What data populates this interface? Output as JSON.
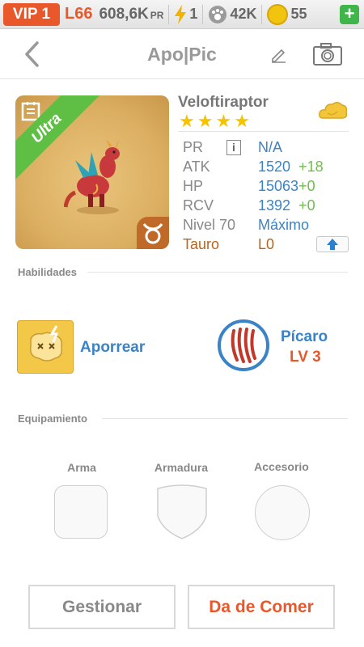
{
  "status": {
    "vip": "VIP 1",
    "level": "L66",
    "power": "608,6K",
    "power_unit": "PR",
    "energy": "1",
    "paws": "42K",
    "coins": "55",
    "plus": "+"
  },
  "header": {
    "title": "Apo|Pic"
  },
  "pet": {
    "rarity": "Ultra",
    "name": "Veloftiraptor",
    "stars": 4,
    "stats": [
      {
        "label": "PR",
        "value": "N/A",
        "bonus": ""
      },
      {
        "label": "ATK",
        "value": "1520",
        "bonus": "+18"
      },
      {
        "label": "HP",
        "value": "15063",
        "bonus": "+0"
      },
      {
        "label": "RCV",
        "value": "1392",
        "bonus": "+0"
      },
      {
        "label": "Nivel 70",
        "value": "Máximo",
        "bonus": ""
      },
      {
        "label": "Tauro",
        "value": "L0",
        "bonus": ""
      }
    ],
    "info_icon": "i"
  },
  "skills": {
    "title": "Habilidades",
    "items": [
      {
        "name": "Aporrear",
        "level": ""
      },
      {
        "name": "Pícaro",
        "level": "LV 3"
      }
    ]
  },
  "equipment": {
    "title": "Equipamiento",
    "slots": [
      "Arma",
      "Armadura",
      "Accesorio"
    ]
  },
  "buttons": {
    "manage": "Gestionar",
    "feed": "Da de Comer"
  },
  "colors": {
    "accent": "#e8582a",
    "blue": "#3b83c7",
    "green": "#5fbf45",
    "star": "#f5c400"
  }
}
